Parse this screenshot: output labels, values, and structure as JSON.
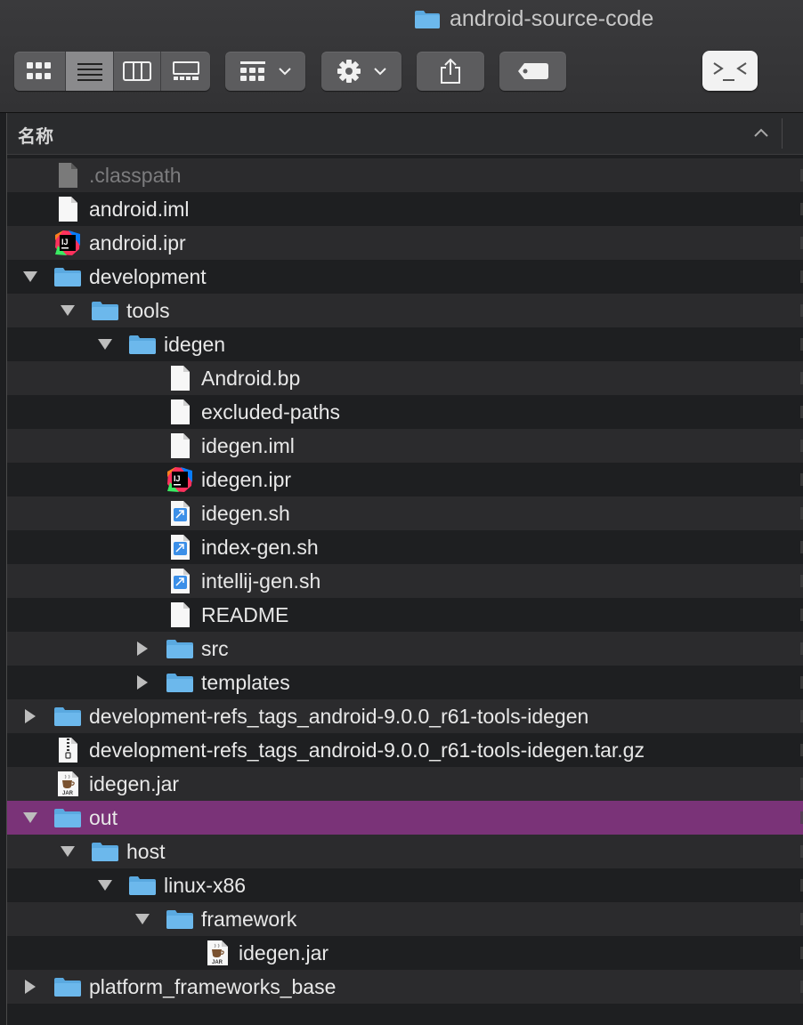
{
  "window": {
    "title": "android-source-code"
  },
  "toolbar": {
    "view_modes": [
      "icon-view",
      "list-view",
      "column-view",
      "gallery-view"
    ],
    "active_view": "list-view",
    "group_button_icon": "group-by-icon",
    "action_button_icon": "gear-icon",
    "share_button_icon": "share-icon",
    "tag_button_icon": "tag-icon",
    "terminal_label": ">_<"
  },
  "column_header": {
    "name_label": "名称",
    "sort_direction": "ascending"
  },
  "colors": {
    "selection": "#7a3378",
    "folder": "#5aa9e0",
    "row_odd": "#2b2b2d",
    "row_even": "#1e1f21"
  },
  "rows": [
    {
      "name": ".classpath",
      "level": 0,
      "kind": "file-dim",
      "expand": "none"
    },
    {
      "name": "android.iml",
      "level": 0,
      "kind": "file",
      "expand": "none"
    },
    {
      "name": "android.ipr",
      "level": 0,
      "kind": "intellij",
      "expand": "none"
    },
    {
      "name": "development",
      "level": 0,
      "kind": "folder",
      "expand": "open"
    },
    {
      "name": "tools",
      "level": 1,
      "kind": "folder",
      "expand": "open"
    },
    {
      "name": "idegen",
      "level": 2,
      "kind": "folder",
      "expand": "open"
    },
    {
      "name": "Android.bp",
      "level": 3,
      "kind": "file",
      "expand": "none"
    },
    {
      "name": "excluded-paths",
      "level": 3,
      "kind": "file",
      "expand": "none"
    },
    {
      "name": "idegen.iml",
      "level": 3,
      "kind": "file",
      "expand": "none"
    },
    {
      "name": "idegen.ipr",
      "level": 3,
      "kind": "intellij",
      "expand": "none"
    },
    {
      "name": "idegen.sh",
      "level": 3,
      "kind": "script",
      "expand": "none"
    },
    {
      "name": "index-gen.sh",
      "level": 3,
      "kind": "script",
      "expand": "none"
    },
    {
      "name": "intellij-gen.sh",
      "level": 3,
      "kind": "script",
      "expand": "none"
    },
    {
      "name": "README",
      "level": 3,
      "kind": "file",
      "expand": "none"
    },
    {
      "name": "src",
      "level": 3,
      "kind": "folder",
      "expand": "closed"
    },
    {
      "name": "templates",
      "level": 3,
      "kind": "folder",
      "expand": "closed"
    },
    {
      "name": "development-refs_tags_android-9.0.0_r61-tools-idegen",
      "level": 0,
      "kind": "folder",
      "expand": "closed"
    },
    {
      "name": "development-refs_tags_android-9.0.0_r61-tools-idegen.tar.gz",
      "level": 0,
      "kind": "archive",
      "expand": "none"
    },
    {
      "name": "idegen.jar",
      "level": 0,
      "kind": "jar",
      "expand": "none"
    },
    {
      "name": "out",
      "level": 0,
      "kind": "folder",
      "expand": "open",
      "selected": true
    },
    {
      "name": "host",
      "level": 1,
      "kind": "folder",
      "expand": "open"
    },
    {
      "name": "linux-x86",
      "level": 2,
      "kind": "folder",
      "expand": "open"
    },
    {
      "name": "framework",
      "level": 3,
      "kind": "folder",
      "expand": "open"
    },
    {
      "name": "idegen.jar",
      "level": 4,
      "kind": "jar",
      "expand": "none"
    },
    {
      "name": "platform_frameworks_base",
      "level": 0,
      "kind": "folder",
      "expand": "closed"
    }
  ]
}
